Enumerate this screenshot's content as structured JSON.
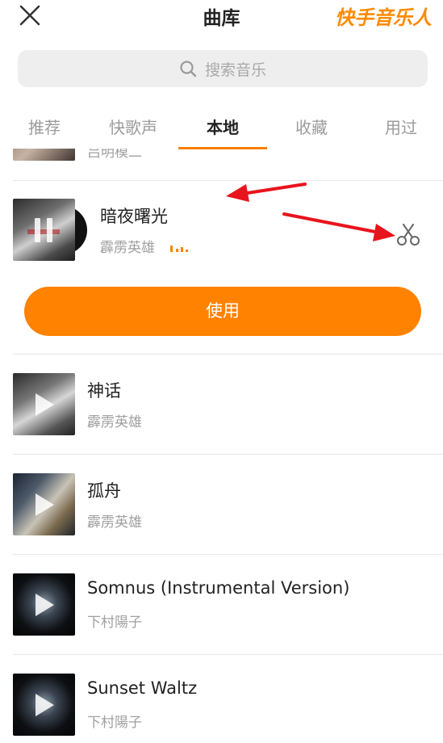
{
  "header": {
    "title": "曲库",
    "brand": "快手音乐人"
  },
  "search": {
    "placeholder": "搜索音乐"
  },
  "tabs": [
    {
      "label": "推荐"
    },
    {
      "label": "快歌声"
    },
    {
      "label": "本地"
    },
    {
      "label": "收藏"
    },
    {
      "label": "用过"
    }
  ],
  "active_tab": "本地",
  "partial_item": {
    "artist_fragment": "吕明模二"
  },
  "selected_song": {
    "title": "暗夜曙光",
    "artist": "霹雳英雄",
    "use_label": "使用"
  },
  "songs": [
    {
      "title": "神话",
      "artist": "霹雳英雄"
    },
    {
      "title": "孤舟",
      "artist": "霹雳英雄"
    },
    {
      "title": "Somnus (Instrumental Version)",
      "artist": "下村陽子"
    },
    {
      "title": "Sunset Waltz",
      "artist": "下村陽子"
    }
  ],
  "colors": {
    "accent": "#ff8200",
    "annotation_arrow": "#e8141c"
  },
  "icons": {
    "close": "close-icon",
    "search": "search-icon",
    "scissors": "scissors-icon",
    "pause": "pause-icon",
    "play": "play-icon"
  }
}
